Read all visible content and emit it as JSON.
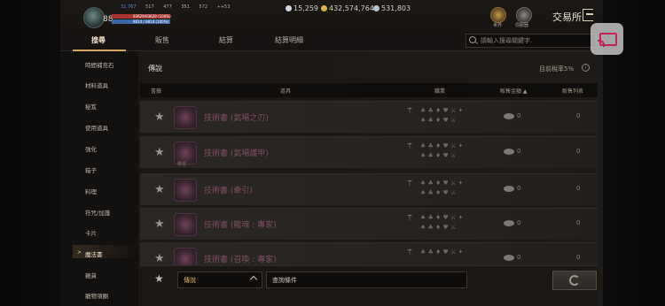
{
  "hud": {
    "level": "88",
    "stats": [
      "32,767",
      "517",
      "477",
      "351",
      "572",
      "++53"
    ],
    "hp_label": "93629/93629 (100%)",
    "mp_label": "8814 / 8814 (100%)",
    "hp_fill": 1.0,
    "mp_fill": 1.0
  },
  "currencies": [
    {
      "value": "15,259",
      "icon": "diamond-icon",
      "color": "#cfd6de"
    },
    {
      "value": "432,574,764",
      "icon": "gold-coin-icon",
      "color": "#d8b24a"
    },
    {
      "value": "531,803",
      "icon": "silver-coin-icon",
      "color": "#b7c4cc"
    }
  ],
  "top_buttons": [
    {
      "label": "世界",
      "icon": "world-icon"
    },
    {
      "label": "伺服器",
      "icon": "server-icon"
    }
  ],
  "title": "交易所",
  "tabs": [
    {
      "label": "搜尋",
      "active": true
    },
    {
      "label": "販售",
      "active": false
    },
    {
      "label": "結算",
      "active": false
    },
    {
      "label": "結算明細",
      "active": false
    }
  ],
  "search": {
    "placeholder": "請輸入搜尋關鍵字."
  },
  "sidebar": {
    "items": [
      "時間補充石",
      "材料道具",
      "秘笈",
      "使用道具",
      "強化",
      "箱子",
      "料理",
      "符咒/加護",
      "卡片",
      "魔法書",
      "雜貨",
      "寵物項圈"
    ],
    "active_index": 9
  },
  "section": {
    "title": "傳說",
    "tax": "目前稅率5%",
    "info_icon": "i"
  },
  "table": {
    "headers": [
      "書籤",
      "道具",
      "職業",
      "販售金額 ▲",
      "販售列表"
    ],
    "rows": [
      {
        "name": "技術書 (氣場之刃)",
        "sub": "",
        "amount": "0",
        "listings": "0"
      },
      {
        "name": "技術書 (氣場護甲)",
        "sub": "學習",
        "amount": "0",
        "listings": "0"
      },
      {
        "name": "技術書 (牽引)",
        "sub": "",
        "amount": "0",
        "listings": "0"
      },
      {
        "name": "技術書 (龍魂 : 專家)",
        "sub": "",
        "amount": "0",
        "listings": "0"
      },
      {
        "name": "技術書 (召喚 : 專家)",
        "sub": "",
        "amount": "0",
        "listings": "0"
      }
    ]
  },
  "filter": {
    "grade": "傳說",
    "query": "查詢條件"
  },
  "colors": {
    "accent": "#d3a55f",
    "legend_item": "#7e4c60"
  }
}
